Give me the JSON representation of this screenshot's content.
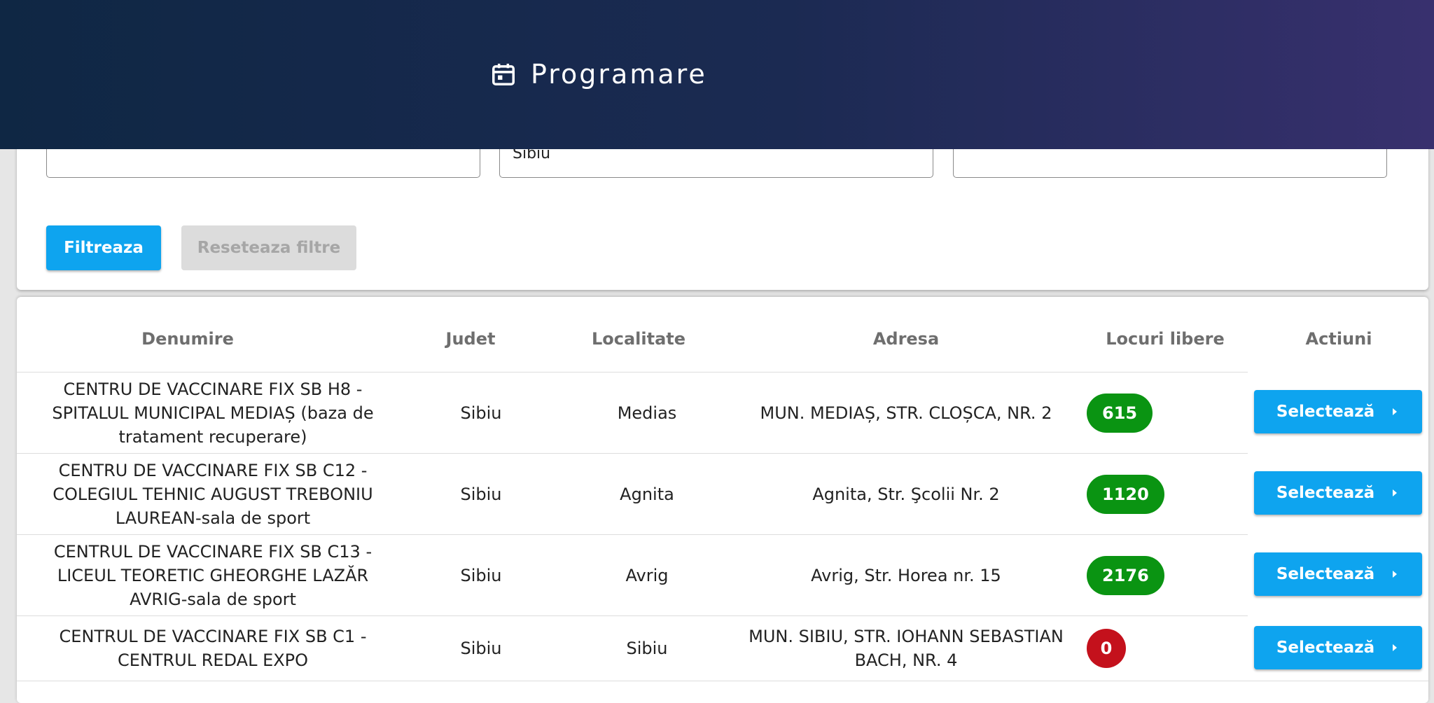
{
  "header": {
    "title": "Programare"
  },
  "filters": {
    "field1_value": "",
    "field2_value": "Sibiu",
    "field3_value": "",
    "filter_label": "Filtreaza",
    "reset_label": "Reseteaza filtre"
  },
  "table": {
    "columns": [
      "Denumire",
      "Judet",
      "Localitate",
      "Adresa",
      "Locuri libere",
      "Actiuni"
    ],
    "action_label": "Selectează",
    "rows": [
      {
        "name": "CENTRU DE VACCINARE FIX SB H8 - SPITALUL MUNICIPAL MEDIAȘ (baza de tratament recuperare)",
        "county": "Sibiu",
        "city": "Medias",
        "address": "MUN. MEDIAȘ, STR. CLOȘCA, NR. 2",
        "free": "615"
      },
      {
        "name": "CENTRU DE VACCINARE FIX SB C12 - COLEGIUL TEHNIC AUGUST TREBONIU LAUREAN-sala de sport",
        "county": "Sibiu",
        "city": "Agnita",
        "address": "Agnita, Str. Şcolii Nr. 2",
        "free": "1120"
      },
      {
        "name": "CENTRUL DE VACCINARE FIX SB C13 - LICEUL TEORETIC GHEORGHE LAZĂR AVRIG-sala de sport",
        "county": "Sibiu",
        "city": "Avrig",
        "address": "Avrig, Str. Horea nr. 15",
        "free": "2176"
      },
      {
        "name": "CENTRUL DE VACCINARE FIX SB C1 - CENTRUL REDAL EXPO",
        "county": "Sibiu",
        "city": "Sibiu",
        "address": "MUN. SIBIU, STR. IOHANN SEBASTIAN BACH, NR. 4",
        "free": "0"
      }
    ]
  },
  "colors": {
    "accent": "#0ea4ef",
    "available": "#0a9412",
    "unavailable": "#c4111c"
  }
}
